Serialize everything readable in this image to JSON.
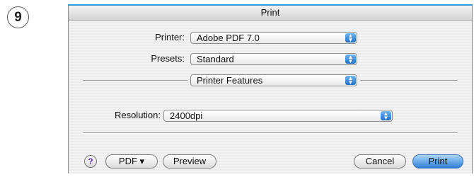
{
  "step_number": "9",
  "window": {
    "title": "Print"
  },
  "printer": {
    "label": "Printer:",
    "value": "Adobe PDF 7.0"
  },
  "presets": {
    "label": "Presets:",
    "value": "Standard"
  },
  "panel": {
    "value": "Printer Features"
  },
  "resolution": {
    "label": "Resolution:",
    "value": "2400dpi"
  },
  "buttons": {
    "help": "?",
    "pdf": "PDF ▾",
    "preview": "Preview",
    "cancel": "Cancel",
    "print": "Print"
  },
  "colors": {
    "accent": "#2f7fd6",
    "title_border": "#2e9ad8"
  },
  "icons": {
    "popup_arrows": "updown-arrows-icon",
    "help": "help-icon"
  }
}
